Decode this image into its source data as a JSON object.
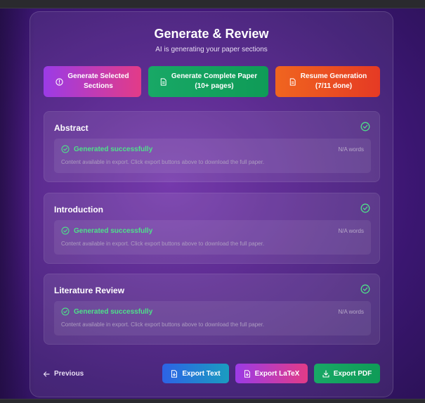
{
  "header": {
    "title": "Generate & Review",
    "subtitle": "AI is generating your paper sections"
  },
  "actions": {
    "generate_selected": {
      "line1": "Generate Selected",
      "line2": "Sections",
      "icon": "alert-circle-icon"
    },
    "generate_complete": {
      "line1": "Generate Complete Paper",
      "line2": "(10+ pages)",
      "icon": "document-icon"
    },
    "resume_generation": {
      "line1": "Resume Generation",
      "line2": "(7/11 done)",
      "icon": "document-icon"
    }
  },
  "sections": [
    {
      "title": "Abstract",
      "status": "Generated successfully",
      "words": "N/A words",
      "note": "Content available in export. Click export buttons above to download the full paper."
    },
    {
      "title": "Introduction",
      "status": "Generated successfully",
      "words": "N/A words",
      "note": "Content available in export. Click export buttons above to download the full paper."
    },
    {
      "title": "Literature Review",
      "status": "Generated successfully",
      "words": "N/A words",
      "note": "Content available in export. Click export buttons above to download the full paper."
    }
  ],
  "footer": {
    "previous": "Previous",
    "export_text": "Export Text",
    "export_latex": "Export LaTeX",
    "export_pdf": "Export PDF"
  },
  "colors": {
    "success": "#4ee08a",
    "purple_pink_gradient": [
      "#9b3be6",
      "#e33b87"
    ],
    "green": "#18a866",
    "orange_red": [
      "#f0651f",
      "#e53a24"
    ],
    "blue_cyan": [
      "#2d63e6",
      "#1a9cc0"
    ]
  }
}
